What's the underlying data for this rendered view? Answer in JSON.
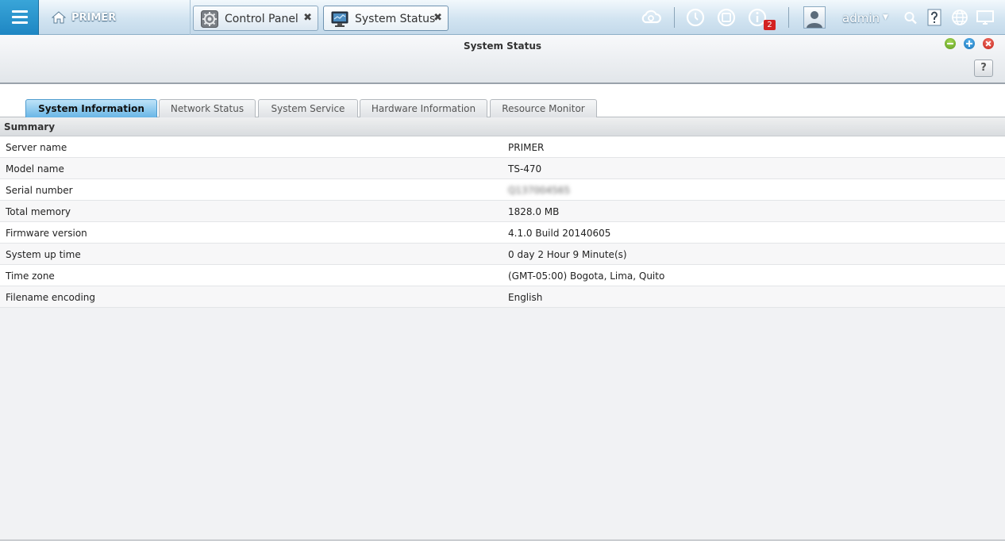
{
  "topbar": {
    "home_label": "PRIMER",
    "tabs": [
      {
        "label": "Control Panel",
        "close": "✖"
      },
      {
        "label": "System Status",
        "close": "✖"
      }
    ],
    "notification_count": "2",
    "user": "admin",
    "user_caret": "▼"
  },
  "window": {
    "title": "System Status",
    "help_label": "?"
  },
  "subtabs": [
    "System Information",
    "Network Status",
    "System Service",
    "Hardware Information",
    "Resource Monitor"
  ],
  "summary": {
    "heading": "Summary",
    "rows": [
      {
        "label": "Server name",
        "value": "PRIMER"
      },
      {
        "label": "Model name",
        "value": "TS-470"
      },
      {
        "label": "Serial number",
        "value": "Q137004565"
      },
      {
        "label": "Total memory",
        "value": "1828.0 MB"
      },
      {
        "label": "Firmware version",
        "value": "4.1.0 Build 20140605"
      },
      {
        "label": "System up time",
        "value": "0 day 2 Hour 9 Minute(s)"
      },
      {
        "label": "Time zone",
        "value": "(GMT-05:00) Bogota, Lima, Quito"
      },
      {
        "label": "Filename encoding",
        "value": "English"
      }
    ]
  },
  "colors": {
    "menu_blue": "#1e86c3",
    "active_subtab": "#69b6e6",
    "badge_red": "#d32222"
  }
}
